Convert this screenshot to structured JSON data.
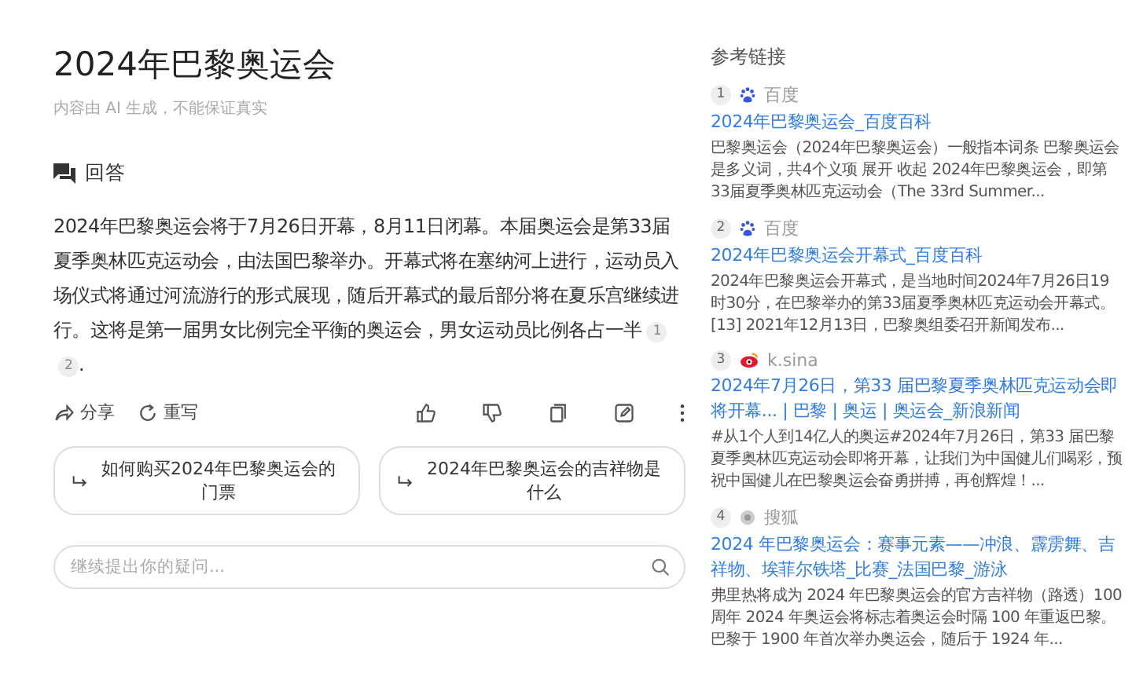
{
  "title": "2024年巴黎奥运会",
  "disclaimer": "内容由 AI 生成，不能保证真实",
  "answer_label": "回答",
  "answer": {
    "text": "2024年巴黎奥运会将于7月26日开幕，8月11日闭幕。本届奥运会是第33届夏季奥林匹克运动会，由法国巴黎举办。开幕式将在塞纳河上进行，运动员入场仪式将通过河流游行的形式展现，随后开幕式的最后部分将在夏乐宫继续进行。这将是第一届男女比例完全平衡的奥运会，男女运动员比例各占一半",
    "citations": [
      "1",
      "2"
    ],
    "end": "."
  },
  "actions": [
    {
      "label": "分享",
      "kind": "share"
    },
    {
      "label": "重写",
      "kind": "rewrite"
    }
  ],
  "tools": [
    {
      "kind": "like"
    },
    {
      "kind": "dislike"
    },
    {
      "kind": "copy"
    },
    {
      "kind": "edit"
    },
    {
      "kind": "more"
    }
  ],
  "suggestions": [
    "如何购买2024年巴黎奥运会的门票",
    "2024年巴黎奥运会的吉祥物是什么"
  ],
  "ask_field": {
    "placeholder": "继续提出你的疑问..."
  },
  "references": {
    "title": "参考链接",
    "items": [
      {
        "index": "1",
        "kind": "paw",
        "source": "百度",
        "link": "2024年巴黎奥运会_百度百科",
        "snippet": "巴黎奥运会（2024年巴黎奥运会）一般指本词条 巴黎奥运会是多义词，共4个义项 展开 收起 2024年巴黎奥运会，即第33届夏季奥林匹克运动会（The 33rd Summer..."
      },
      {
        "index": "2",
        "kind": "paw",
        "source": "百度",
        "link": "2024年巴黎奥运会开幕式_百度百科",
        "snippet": "2024年巴黎奥运会开幕式，是当地时间2024年7月26日19时30分，在巴黎举办的第33届夏季奥林匹克运动会开幕式。 [13] 2021年12月13日，巴黎奥组委召开新闻发布..."
      },
      {
        "index": "3",
        "kind": "eye",
        "source": "k.sina",
        "link": "2024年7月26日，第33 届巴黎夏季奥林匹克运动会即将开幕... | 巴黎 | 奥运 | 奥运会_新浪新闻",
        "snippet": "#从1个人到14亿人的奥运#2024年7月26日，第33 届巴黎夏季奥林匹克运动会即将开幕，让我们为中国健儿们喝彩，预祝中国健儿在巴黎奥运会奋勇拼搏，再创辉煌！..."
      },
      {
        "index": "4",
        "kind": "dot",
        "source": "搜狐",
        "link": "2024 年巴黎奥运会：赛事元素——冲浪、霹雳舞、吉祥物、埃菲尔铁塔_比赛_法国巴黎_游泳",
        "snippet": "弗里热将成为 2024 年巴黎奥运会的官方吉祥物（路透）100 周年 2024 年奥运会将标志着奥运会时隔 100 年重返巴黎。巴黎于 1900 年首次举办奥运会，随后于 1924 年..."
      }
    ]
  }
}
